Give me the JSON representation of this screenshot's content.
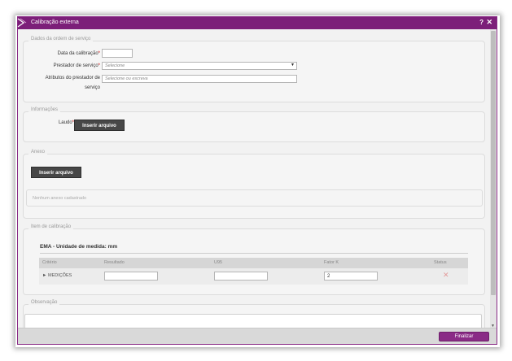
{
  "window": {
    "title": "Calibração externa",
    "help_label": "?",
    "close_label": "✕"
  },
  "sections": {
    "service_order": {
      "legend": "Dados da ordem de serviço",
      "calibration_date_label": "Data da calibração",
      "calibration_date_value": "",
      "provider_label": "Prestador de serviço",
      "provider_placeholder": "Selecione",
      "provider_attributes_label_line1": "Atributos do prestador de",
      "provider_attributes_label_line2": "serviço",
      "provider_attributes_placeholder": "Selecione ou escreva"
    },
    "information": {
      "legend": "Informações",
      "report_label": "Laudo",
      "insert_file_label": "Inserir arquivo"
    },
    "attachment": {
      "legend": "Anexo",
      "insert_file_label": "Inserir arquivo",
      "empty_text": "Nenhum anexo cadastrado"
    },
    "calibration_item": {
      "legend": "Item de calibração",
      "item_title": "EMA - Unidade de medida: mm",
      "columns": [
        "Critério",
        "Resultado",
        "U95",
        "Fator K",
        "Status"
      ],
      "rows": [
        {
          "criterion": "MEDIÇÕES",
          "result": "",
          "u95": "",
          "k_factor": "2",
          "status_icon": "remove-icon"
        }
      ]
    },
    "observation": {
      "legend": "Observação",
      "value": ""
    }
  },
  "footer": {
    "finish_label": "Finalizar"
  },
  "colors": {
    "accent": "#7c1f79",
    "button_dark": "#474747"
  }
}
